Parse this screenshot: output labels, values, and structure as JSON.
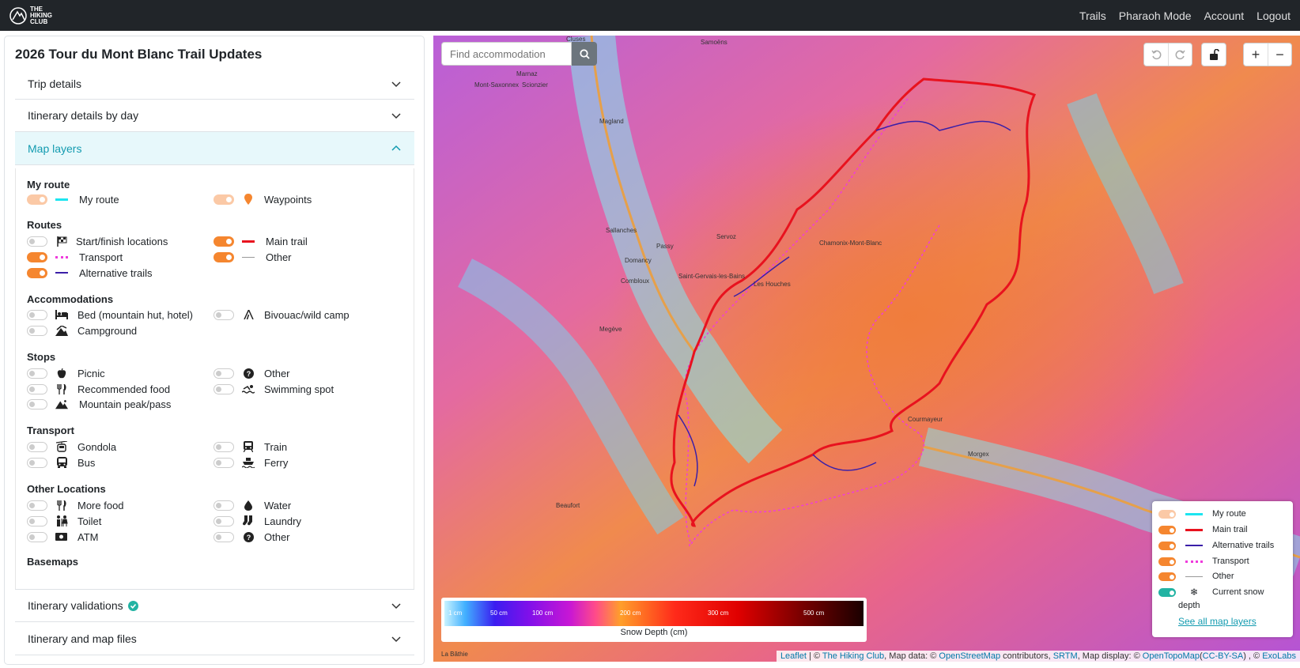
{
  "nav": {
    "brand_line1": "THE",
    "brand_line2": "HIKING",
    "brand_line3": "CLUB",
    "links": [
      "Trails",
      "Pharaoh Mode",
      "Account",
      "Logout"
    ]
  },
  "panel": {
    "title": "2026 Tour du Mont Blanc Trail Updates",
    "accordions": [
      "Trip details",
      "Itinerary details by day",
      "Map layers",
      "Itinerary validations",
      "Itinerary and map files"
    ],
    "sections": {
      "my_route": "My route",
      "routes": "Routes",
      "accommodations": "Accommodations",
      "stops": "Stops",
      "transport": "Transport",
      "other_locations": "Other Locations",
      "basemaps": "Basemaps"
    },
    "items": {
      "my_route": "My route",
      "waypoints": "Waypoints",
      "start_finish": "Start/finish locations",
      "main_trail": "Main trail",
      "transport": "Transport",
      "other": "Other",
      "alt_trails": "Alternative trails",
      "bed": "Bed (mountain hut, hotel)",
      "bivouac": "Bivouac/wild camp",
      "campground": "Campground",
      "picnic": "Picnic",
      "stop_other": "Other",
      "rec_food": "Recommended food",
      "swimming": "Swimming spot",
      "peak": "Mountain peak/pass",
      "gondola": "Gondola",
      "train": "Train",
      "bus": "Bus",
      "ferry": "Ferry",
      "more_food": "More food",
      "water": "Water",
      "toilet": "Toilet",
      "laundry": "Laundry",
      "atm": "ATM",
      "loc_other": "Other"
    }
  },
  "map": {
    "search_placeholder": "Find accommodation",
    "snow_labels": [
      "1 cm",
      "50 cm",
      "100 cm",
      "200 cm",
      "300 cm",
      "500 cm"
    ],
    "snow_title": "Snow Depth (cm)",
    "legend": {
      "my_route": "My route",
      "main_trail": "Main trail",
      "alt_trails": "Alternative trails",
      "transport": "Transport",
      "other": "Other",
      "snow_line1": "Current snow",
      "snow_line2": "depth",
      "see_all": "See all map layers"
    },
    "attribution": {
      "leaflet": "Leaflet",
      "sep1": " | © ",
      "thc": "The Hiking Club",
      "mid": ", Map data: © ",
      "osm": "OpenStreetMap",
      "contrib": " contributors, ",
      "srtm": "SRTM",
      "disp": ", Map display: © ",
      "otm": "OpenTopoMap",
      "lp": "(",
      "cc": "CC-BY-SA",
      "rp": ") , © ",
      "exo": "ExoLabs"
    },
    "place_labels": [
      "Cluses",
      "Samoëns",
      "Sallanches",
      "Passy",
      "Servoz",
      "Domancy",
      "Combloux",
      "Saint-Gervais-les-Bains",
      "Les Houches",
      "Chamonix-Mont-Blanc",
      "Courmayeur",
      "Morgex",
      "Megève",
      "Beaufort",
      "Magland",
      "Mont-Saxonnex",
      "Scionzier",
      "Marnaz",
      "La Bâthie"
    ]
  },
  "colors": {
    "accent_orange": "#f5862f",
    "main_trail": "#e8121e",
    "my_route": "#1de5f0",
    "alt_trail": "#3a1fa8",
    "transport": "#ef3bdc",
    "teal": "#22b3a3"
  }
}
